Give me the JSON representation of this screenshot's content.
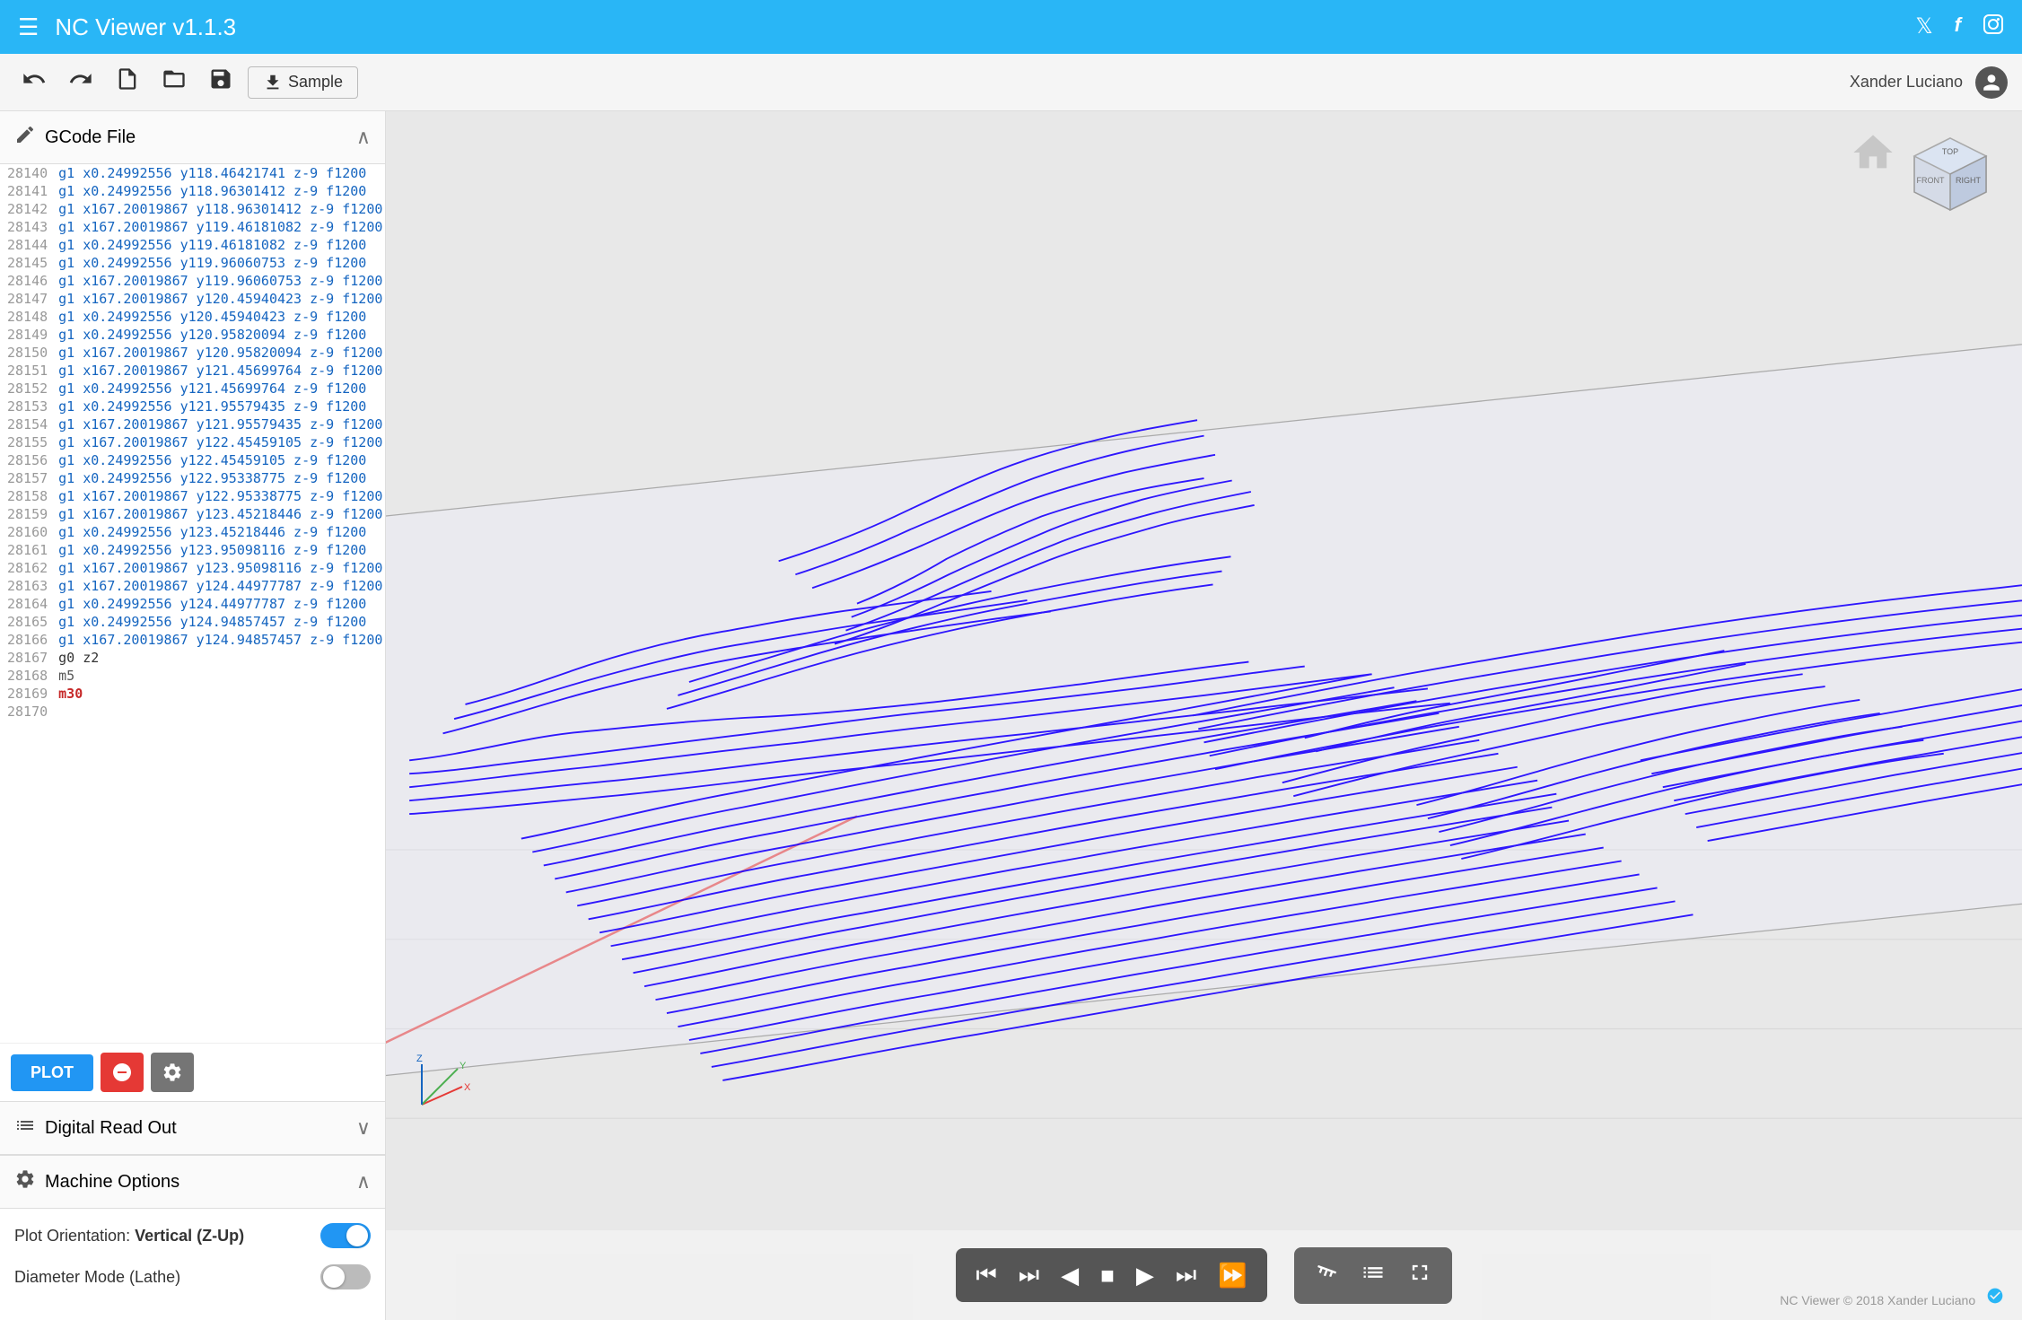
{
  "topbar": {
    "menu_icon": "☰",
    "title": "NC Viewer  v1.1.3",
    "social": [
      "🐦",
      "f",
      "📷"
    ]
  },
  "toolbar": {
    "undo_label": "↩",
    "redo_label": "↪",
    "new_label": "📄",
    "open_label": "📂",
    "save_label": "💾",
    "download_icon": "⬇",
    "sample_label": "Sample",
    "user_name": "Xander Luciano",
    "avatar_icon": "👤"
  },
  "gcode_section": {
    "title": "GCode File",
    "icon": "✏",
    "chevron": "∧",
    "lines": [
      {
        "num": "28140",
        "code": "g1 x0.24992556 y118.46421741 z-9 f1200",
        "type": "g1"
      },
      {
        "num": "28141",
        "code": "g1 x0.24992556 y118.96301412 z-9 f1200",
        "type": "g1"
      },
      {
        "num": "28142",
        "code": "g1 x167.20019867 y118.96301412 z-9 f1200",
        "type": "g1"
      },
      {
        "num": "28143",
        "code": "g1 x167.20019867 y119.46181082 z-9 f1200",
        "type": "g1"
      },
      {
        "num": "28144",
        "code": "g1 x0.24992556 y119.46181082 z-9 f1200",
        "type": "g1"
      },
      {
        "num": "28145",
        "code": "g1 x0.24992556 y119.96060753 z-9 f1200",
        "type": "g1"
      },
      {
        "num": "28146",
        "code": "g1 x167.20019867 y119.96060753 z-9 f1200",
        "type": "g1"
      },
      {
        "num": "28147",
        "code": "g1 x167.20019867 y120.45940423 z-9 f1200",
        "type": "g1"
      },
      {
        "num": "28148",
        "code": "g1 x0.24992556 y120.45940423 z-9 f1200",
        "type": "g1"
      },
      {
        "num": "28149",
        "code": "g1 x0.24992556 y120.95820094 z-9 f1200",
        "type": "g1"
      },
      {
        "num": "28150",
        "code": "g1 x167.20019867 y120.95820094 z-9 f1200",
        "type": "g1"
      },
      {
        "num": "28151",
        "code": "g1 x167.20019867 y121.45699764 z-9 f1200",
        "type": "g1"
      },
      {
        "num": "28152",
        "code": "g1 x0.24992556 y121.45699764 z-9 f1200",
        "type": "g1"
      },
      {
        "num": "28153",
        "code": "g1 x0.24992556 y121.95579435 z-9 f1200",
        "type": "g1"
      },
      {
        "num": "28154",
        "code": "g1 x167.20019867 y121.95579435 z-9 f1200",
        "type": "g1"
      },
      {
        "num": "28155",
        "code": "g1 x167.20019867 y122.45459105 z-9 f1200",
        "type": "g1"
      },
      {
        "num": "28156",
        "code": "g1 x0.24992556 y122.45459105 z-9 f1200",
        "type": "g1"
      },
      {
        "num": "28157",
        "code": "g1 x0.24992556 y122.95338775 z-9 f1200",
        "type": "g1"
      },
      {
        "num": "28158",
        "code": "g1 x167.20019867 y122.95338775 z-9 f1200",
        "type": "g1"
      },
      {
        "num": "28159",
        "code": "g1 x167.20019867 y123.45218446 z-9 f1200",
        "type": "g1"
      },
      {
        "num": "28160",
        "code": "g1 x0.24992556 y123.45218446 z-9 f1200",
        "type": "g1"
      },
      {
        "num": "28161",
        "code": "g1 x0.24992556 y123.95098116 z-9 f1200",
        "type": "g1"
      },
      {
        "num": "28162",
        "code": "g1 x167.20019867 y123.95098116 z-9 f1200",
        "type": "g1"
      },
      {
        "num": "28163",
        "code": "g1 x167.20019867 y124.44977787 z-9 f1200",
        "type": "g1"
      },
      {
        "num": "28164",
        "code": "g1 x0.24992556 y124.44977787 z-9 f1200",
        "type": "g1"
      },
      {
        "num": "28165",
        "code": "g1 x0.24992556 y124.94857457 z-9 f1200",
        "type": "g1"
      },
      {
        "num": "28166",
        "code": "g1 x167.20019867 y124.94857457 z-9 f1200",
        "type": "g1"
      },
      {
        "num": "28167",
        "code": "g0 z2",
        "type": "g0"
      },
      {
        "num": "28168",
        "code": "m5",
        "type": "m"
      },
      {
        "num": "28169",
        "code": "m30",
        "type": "m30"
      },
      {
        "num": "28170",
        "code": "",
        "type": "empty"
      }
    ]
  },
  "plot_controls": {
    "plot_label": "PLOT",
    "stop_icon": "⊘",
    "settings_icon": "⚙"
  },
  "dro_section": {
    "title": "Digital Read Out",
    "icon": "≡",
    "chevron": "∨"
  },
  "machine_options": {
    "title": "Machine Options",
    "icon": "⚙",
    "chevron": "∧",
    "options": [
      {
        "label": "Plot Orientation: ",
        "label_strong": "Vertical (Z-Up)",
        "toggle_on": true
      },
      {
        "label": "Diameter Mode (Lathe)",
        "label_strong": "",
        "toggle_on": false
      }
    ]
  },
  "transport": {
    "buttons": [
      "⏮",
      "⏭",
      "◀",
      "■",
      "▶",
      "⏭",
      "⏩"
    ],
    "tools": [
      "🧪",
      "≡",
      "⤢"
    ]
  },
  "footer": {
    "copyright": "NC Viewer © 2018 Xander Luciano",
    "icon": "🔵"
  },
  "colors": {
    "topbar_bg": "#29b6f6",
    "accent_blue": "#2196f3",
    "gcode_blue": "#1565c0",
    "gcode_red": "#c62828",
    "toggle_on": "#2196f3",
    "toggle_off": "#bbb"
  }
}
